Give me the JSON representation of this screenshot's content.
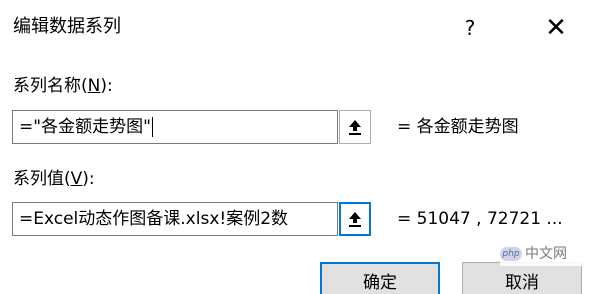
{
  "dialog": {
    "title": "编辑数据系列",
    "help_label": "?",
    "close_label": "✕"
  },
  "series_name": {
    "label_prefix": "系列名称(",
    "label_accel": "N",
    "label_suffix": "):",
    "input_value": "=\"各金额走势图\"",
    "preview": "= 各金额走势图",
    "collapse_icon": "range-select-icon"
  },
  "series_values": {
    "label_prefix": "系列值(",
    "label_accel": "V",
    "label_suffix": "):",
    "input_value": "=Excel动态作图备课.xlsx!案例2数",
    "preview": "= 51047 , 72721 ...",
    "collapse_icon": "range-select-icon"
  },
  "buttons": {
    "ok_label": "确定",
    "cancel_label": "取消"
  },
  "watermark": {
    "badge": "php",
    "text": "中文网"
  }
}
